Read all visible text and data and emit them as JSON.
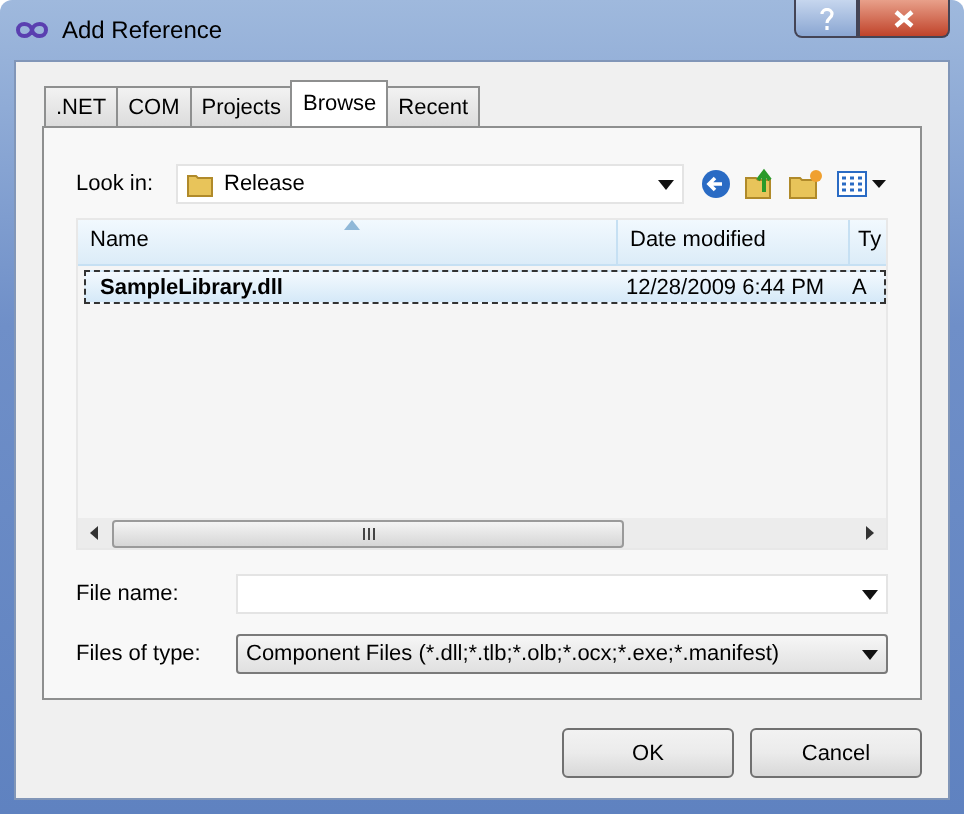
{
  "window": {
    "title": "Add Reference"
  },
  "tabs": [
    {
      "label": ".NET",
      "selected": false
    },
    {
      "label": "COM",
      "selected": false
    },
    {
      "label": "Projects",
      "selected": false
    },
    {
      "label": "Browse",
      "selected": true
    },
    {
      "label": "Recent",
      "selected": false
    }
  ],
  "look_in": {
    "label": "Look in:",
    "value": "Release"
  },
  "file_list": {
    "columns": [
      "Name",
      "Date modified",
      "Ty"
    ],
    "rows": [
      {
        "cells": [
          "SampleLibrary.dll",
          "12/28/2009 6:44 PM",
          "A"
        ],
        "selected": true
      }
    ]
  },
  "file_name": {
    "label": "File name:"
  },
  "files_of_type": {
    "label": "Files of type:",
    "value": "Component Files (*.dll;*.tlb;*.olb;*.ocx;*.exe;*.manifest)"
  },
  "buttons": [
    "OK",
    "Cancel"
  ]
}
